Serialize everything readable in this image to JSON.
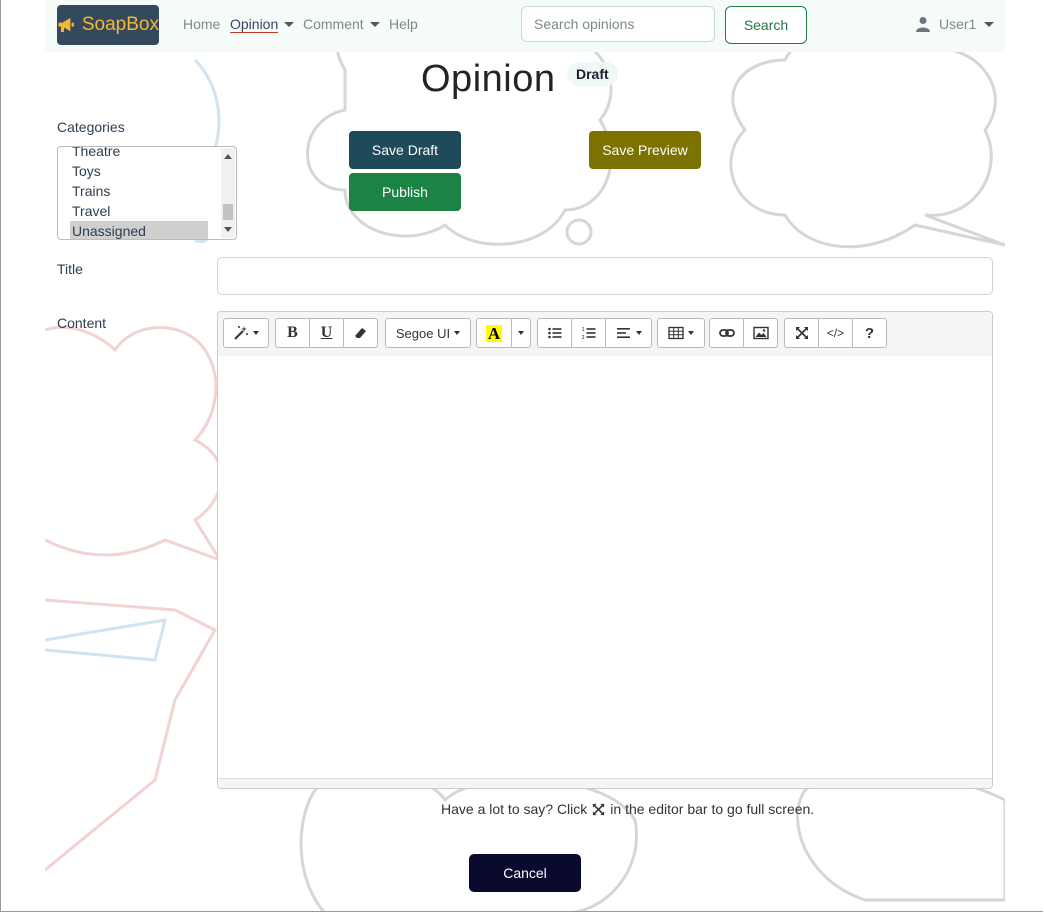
{
  "navbar": {
    "brand": "SoapBox",
    "links": [
      {
        "label": "Home"
      },
      {
        "label": "Opinion"
      },
      {
        "label": "Comment"
      },
      {
        "label": "Help"
      }
    ],
    "search_placeholder": "Search opinions",
    "search_button": "Search",
    "user": "User1"
  },
  "page": {
    "title": "Opinion",
    "status_badge": "Draft"
  },
  "categories": {
    "label": "Categories",
    "items": [
      "Theatre",
      "Toys",
      "Trains",
      "Travel",
      "Unassigned"
    ],
    "selected": "Unassigned"
  },
  "actions": {
    "save_draft": "Save Draft",
    "publish": "Publish",
    "save_preview": "Save Preview",
    "cancel": "Cancel"
  },
  "form": {
    "title_label": "Title",
    "title_value": "",
    "content_label": "Content"
  },
  "editor": {
    "font_name": "Segoe UI",
    "hint_before": "Have a lot to say? Click",
    "hint_after": "in the editor bar to go full screen."
  },
  "colors": {
    "brand_bg": "#34495e",
    "brand_text": "#f5b82e",
    "save_draft": "#1e4a5a",
    "publish": "#1b8445",
    "save_preview": "#7b7200",
    "cancel": "#0a0a2e",
    "search_button": "#1e7b45"
  }
}
